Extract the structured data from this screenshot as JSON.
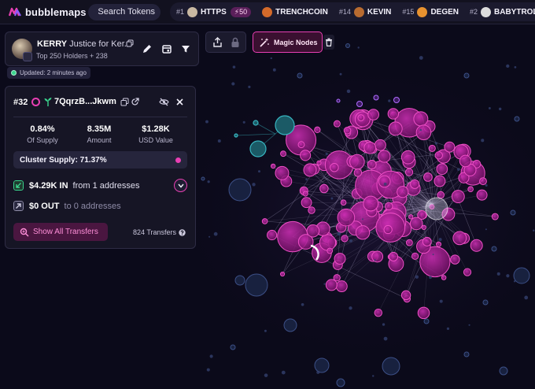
{
  "colors": {
    "accent": "#e83fb3",
    "background": "#0b0a1a",
    "panel": "#161525",
    "cluster_pink": "#c01fa8",
    "cluster_teal": "#37b5c0",
    "far_node": "#2a3a63",
    "positive": "#3bd58e"
  },
  "brand": {
    "name": "bubblemaps",
    "icon": "bubblemaps-logo"
  },
  "search": {
    "label": "Search Tokens",
    "icon": "search-icon"
  },
  "trending": [
    {
      "rank": "#1",
      "name": "HTTPS",
      "badge": "⚡50",
      "avatar_color": "#c8b8a2"
    },
    {
      "rank": "",
      "name": "TRENCHCOIN",
      "badge": "",
      "avatar_color": "#d46a2a"
    },
    {
      "rank": "#14",
      "name": "KEVIN",
      "badge": "",
      "avatar_color": "#b86b30"
    },
    {
      "rank": "#15",
      "name": "DEGEN",
      "badge": "",
      "avatar_color": "#e8922f"
    },
    {
      "rank": "#2",
      "name": "BABYTROLL",
      "badge": "",
      "avatar_color": "#dcdcdc"
    }
  ],
  "token": {
    "symbol": "KERRY",
    "name": "Justice for Ker...",
    "subtitle": "Top 250 Holders + 238",
    "tools": [
      "edit-icon",
      "calendar-icon",
      "filter-icon"
    ]
  },
  "updated": "Updated: 2 minutes ago",
  "toolbar": {
    "share_icon": "share-icon",
    "lock_icon": "lock-icon",
    "magic_label": "Magic Nodes",
    "magic_icon": "magic-wand-icon",
    "trash_icon": "trash-icon"
  },
  "holder": {
    "rank": "#32",
    "address": "7QqrzB...Jkwm",
    "stats": [
      {
        "value": "0.84%",
        "label": "Of Supply"
      },
      {
        "value": "8.35M",
        "label": "Amount"
      },
      {
        "value": "$1.28K",
        "label": "USD Value"
      }
    ],
    "cluster_supply": "Cluster Supply: 71.37%",
    "in_amount": "$4.29K IN",
    "in_from": "from 1 addresses",
    "out_amount": "$0 OUT",
    "out_to": "to 0 addresses",
    "show_transfers": "Show All Transfers",
    "transfer_count": "824 Transfers"
  }
}
